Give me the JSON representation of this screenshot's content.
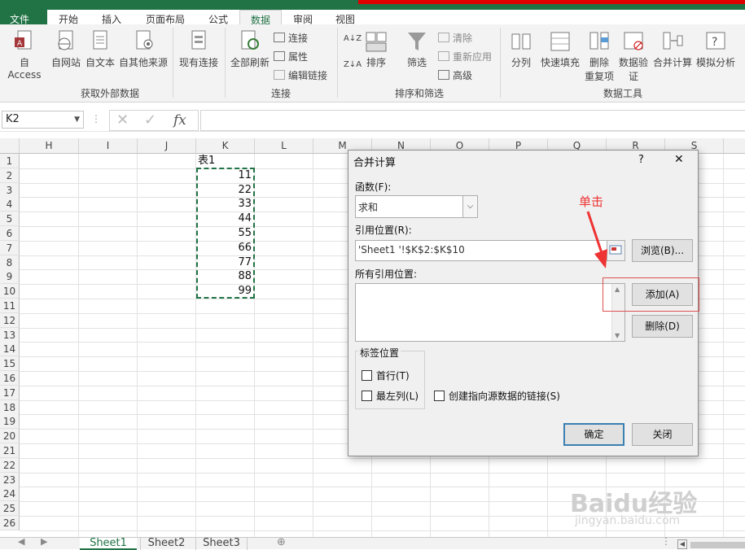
{
  "ribbon_tabs": [
    "文件",
    "开始",
    "插入",
    "页面布局",
    "公式",
    "数据",
    "审阅",
    "视图"
  ],
  "ribbon": {
    "external": {
      "items": [
        "自 Access",
        "自网站",
        "自文本",
        "自其他来源",
        "现有连接"
      ],
      "label": "获取外部数据"
    },
    "connections": {
      "refresh_all": "全部刷新",
      "small": [
        "连接",
        "属性",
        "编辑链接"
      ],
      "label": "连接"
    },
    "sort_filter": {
      "sort": "排序",
      "filter": "筛选",
      "small": [
        "清除",
        "重新应用",
        "高级"
      ],
      "label": "排序和筛选"
    },
    "tools": {
      "items": [
        "分列",
        "快速填充",
        "删除",
        "重复项",
        "数据验",
        "证",
        "合并计算",
        "模拟分析"
      ],
      "label": "数据工具"
    }
  },
  "namebox": "K2",
  "formula": {
    "fx": "fx"
  },
  "columns": [
    "H",
    "I",
    "J",
    "K",
    "L",
    "M",
    "N",
    "O",
    "P",
    "Q",
    "R",
    "S"
  ],
  "rows": [
    "1",
    "2",
    "3",
    "4",
    "5",
    "6",
    "7",
    "8",
    "9",
    "10",
    "11",
    "12",
    "13",
    "14",
    "15",
    "16",
    "17",
    "18",
    "19",
    "20",
    "21",
    "22",
    "23",
    "24",
    "25",
    "26"
  ],
  "table_title": "表1",
  "k_values": [
    "11",
    "22",
    "33",
    "44",
    "55",
    "66",
    "77",
    "88",
    "99"
  ],
  "sheets": [
    "Sheet1",
    "Sheet2",
    "Sheet3"
  ],
  "dialog": {
    "title": "合并计算",
    "help": "?",
    "close": "✕",
    "function_label": "函数(F):",
    "function_value": "求和",
    "ref_label": "引用位置(R):",
    "ref_value": "'Sheet1 '!$K$2:$K$10",
    "browse": "浏览(B)...",
    "all_refs_label": "所有引用位置:",
    "add": "添加(A)",
    "delete": "删除(D)",
    "label_group": "标签位置",
    "top_row": "首行(T)",
    "left_col": "最左列(L)",
    "link": "创建指向源数据的链接(S)",
    "ok": "确定",
    "close_btn": "关闭"
  },
  "annotation": "单击",
  "watermark": "Baidu经验",
  "watermark_url": "jingyan.baidu.com"
}
